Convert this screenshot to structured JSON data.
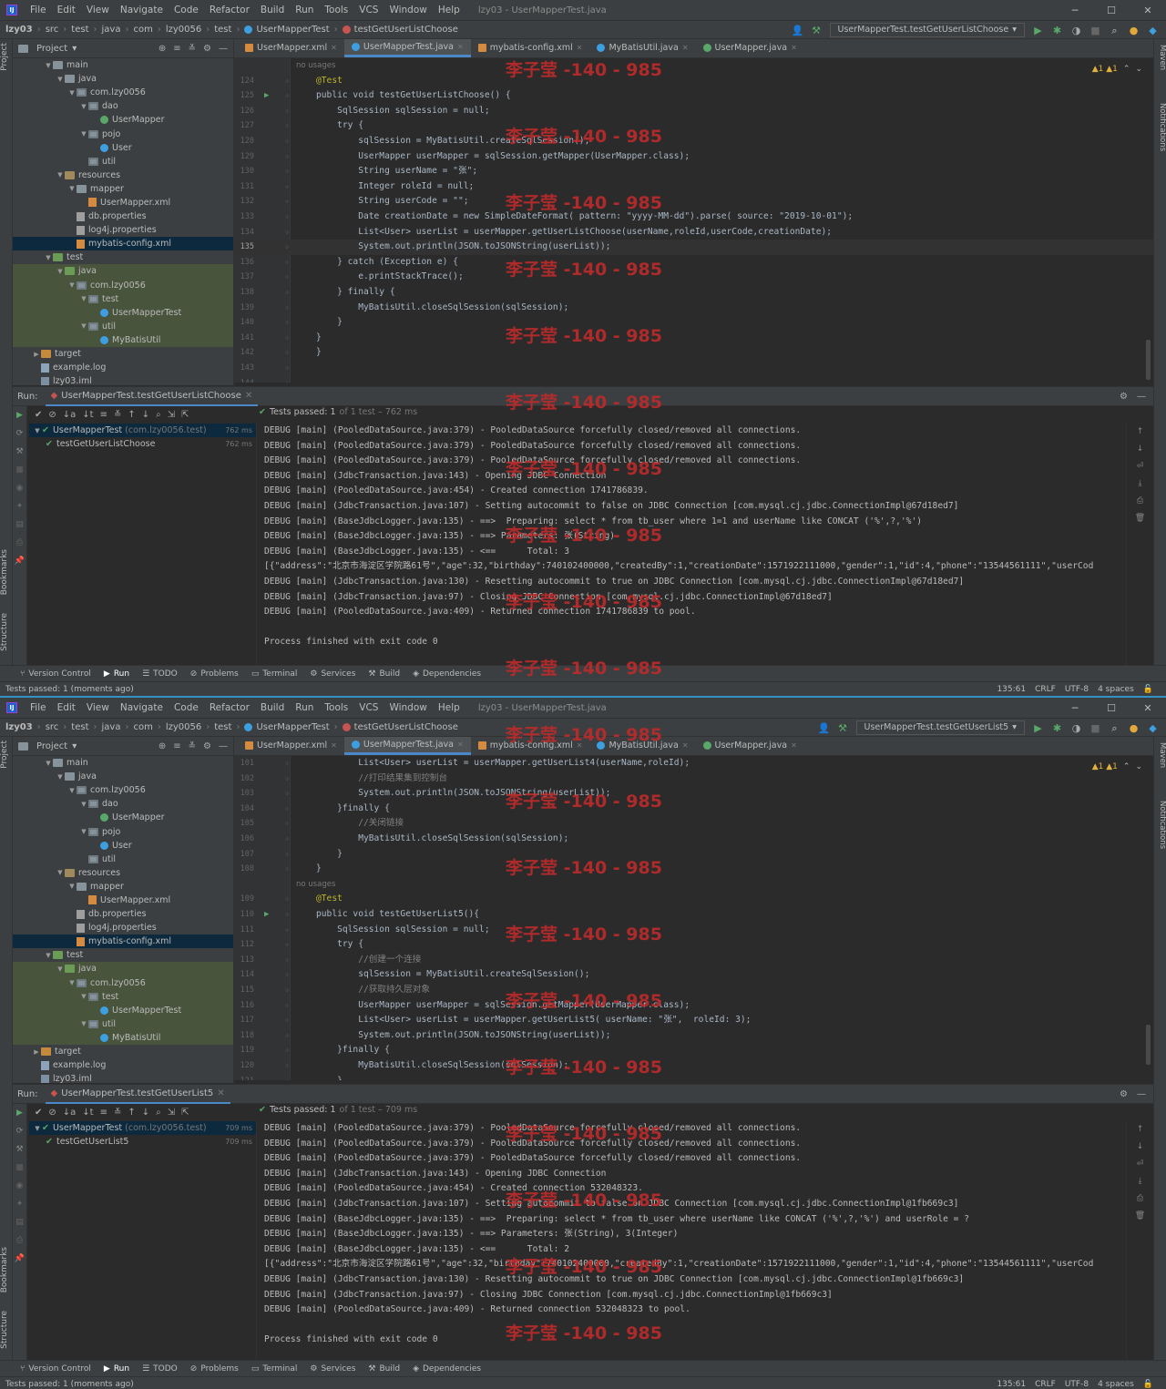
{
  "watermark_text": "李子莹 -140 - 985",
  "w1": {
    "menu": [
      "File",
      "Edit",
      "View",
      "Navigate",
      "Code",
      "Refactor",
      "Build",
      "Run",
      "Tools",
      "VCS",
      "Window",
      "Help"
    ],
    "window_title": "lzy03 - UserMapperTest.java",
    "breadcrumb": [
      "lzy03",
      "src",
      "test",
      "java",
      "com",
      "lzy0056",
      "test",
      "UserMapperTest",
      "testGetUserListChoose"
    ],
    "run_config": "UserMapperTest.testGetUserListChoose",
    "project_label": "Project",
    "tree": [
      {
        "label": "main",
        "indent": 2,
        "icon": "folder",
        "tw": "v"
      },
      {
        "label": "java",
        "indent": 3,
        "icon": "folder",
        "tw": "v"
      },
      {
        "label": "com.lzy0056",
        "indent": 4,
        "icon": "pkg",
        "tw": "v"
      },
      {
        "label": "dao",
        "indent": 5,
        "icon": "pkg",
        "tw": "v"
      },
      {
        "label": "UserMapper",
        "indent": 6,
        "icon": "ifc",
        "tw": ""
      },
      {
        "label": "pojo",
        "indent": 5,
        "icon": "pkg",
        "tw": "v"
      },
      {
        "label": "User",
        "indent": 6,
        "icon": "cls",
        "tw": ""
      },
      {
        "label": "util",
        "indent": 5,
        "icon": "pkg",
        "tw": ""
      },
      {
        "label": "resources",
        "indent": 3,
        "icon": "res",
        "tw": "v"
      },
      {
        "label": "mapper",
        "indent": 4,
        "icon": "folder",
        "tw": "v"
      },
      {
        "label": "UserMapper.xml",
        "indent": 5,
        "icon": "xml",
        "tw": ""
      },
      {
        "label": "db.properties",
        "indent": 4,
        "icon": "prop",
        "tw": ""
      },
      {
        "label": "log4j.properties",
        "indent": 4,
        "icon": "prop",
        "tw": ""
      },
      {
        "label": "mybatis-config.xml",
        "indent": 4,
        "icon": "xml",
        "tw": "",
        "sel": true
      },
      {
        "label": "test",
        "indent": 2,
        "icon": "tst",
        "tw": "v"
      },
      {
        "label": "java",
        "indent": 3,
        "icon": "tst",
        "tw": "v",
        "test": true
      },
      {
        "label": "com.lzy0056",
        "indent": 4,
        "icon": "pkg",
        "tw": "v",
        "test": true
      },
      {
        "label": "test",
        "indent": 5,
        "icon": "pkg",
        "tw": "v",
        "test": true
      },
      {
        "label": "UserMapperTest",
        "indent": 6,
        "icon": "cls",
        "tw": "",
        "test": true
      },
      {
        "label": "util",
        "indent": 5,
        "icon": "pkg",
        "tw": "v",
        "test": true
      },
      {
        "label": "MyBatisUtil",
        "indent": 6,
        "icon": "cls",
        "tw": "",
        "test": true
      },
      {
        "label": "target",
        "indent": 1,
        "icon": "out",
        "tw": ">"
      },
      {
        "label": "example.log",
        "indent": 1,
        "icon": "log",
        "tw": ""
      },
      {
        "label": "lzy03.iml",
        "indent": 1,
        "icon": "iml",
        "tw": ""
      }
    ],
    "tabs": [
      {
        "label": "UserMapper.xml",
        "icon": "xml"
      },
      {
        "label": "UserMapperTest.java",
        "icon": "cls",
        "active": true
      },
      {
        "label": "mybatis-config.xml",
        "icon": "xml"
      },
      {
        "label": "MyBatisUtil.java",
        "icon": "cls"
      },
      {
        "label": "UserMapper.java",
        "icon": "ifc"
      }
    ],
    "warnings": "▲1  ▲1",
    "code": [
      {
        "n": "",
        "t": "no usages",
        "k": "hint"
      },
      {
        "n": "124",
        "t": "@Test",
        "k": "ann"
      },
      {
        "n": "125",
        "t": "public void testGetUserListChoose() {",
        "run": true
      },
      {
        "n": "126",
        "t": "    SqlSession sqlSession = null;"
      },
      {
        "n": "127",
        "t": "    try {"
      },
      {
        "n": "128",
        "t": "        sqlSession = MyBatisUtil.createSqlSession();"
      },
      {
        "n": "129",
        "t": "        UserMapper userMapper = sqlSession.getMapper(UserMapper.class);"
      },
      {
        "n": "130",
        "t": "        String userName = \"张\";"
      },
      {
        "n": "131",
        "t": "        Integer roleId = null;"
      },
      {
        "n": "132",
        "t": "        String userCode = \"\";"
      },
      {
        "n": "133",
        "t": "        Date creationDate = new SimpleDateFormat( pattern: \"yyyy-MM-dd\").parse( source: \"2019-10-01\");"
      },
      {
        "n": "134",
        "t": "        List<User> userList = userMapper.getUserListChoose(userName,roleId,userCode,creationDate);"
      },
      {
        "n": "135",
        "t": "        System.out.println(JSON.toJSONString(userList));",
        "cur": true
      },
      {
        "n": "136",
        "t": "    } catch (Exception e) {"
      },
      {
        "n": "137",
        "t": "        e.printStackTrace();"
      },
      {
        "n": "138",
        "t": "    } finally {"
      },
      {
        "n": "139",
        "t": "        MyBatisUtil.closeSqlSession(sqlSession);"
      },
      {
        "n": "140",
        "t": "    }"
      },
      {
        "n": "141",
        "t": "}"
      },
      {
        "n": "142",
        "t": "}"
      },
      {
        "n": "143",
        "t": ""
      },
      {
        "n": "144",
        "t": ""
      }
    ],
    "run_label": "Run:",
    "run_tab": "UserMapperTest.testGetUserListChoose",
    "tests_passed": "Tests passed: 1",
    "tests_detail": "of 1 test – 762 ms",
    "test_tree": [
      {
        "label": "UserMapperTest",
        "pkg": "(com.lzy0056.test)",
        "time": "762 ms",
        "sel": true,
        "indent": 0
      },
      {
        "label": "testGetUserListChoose",
        "pkg": "",
        "time": "762 ms",
        "indent": 1
      }
    ],
    "console": [
      "DEBUG [main] (PooledDataSource.java:379) - PooledDataSource forcefully closed/removed all connections.",
      "DEBUG [main] (PooledDataSource.java:379) - PooledDataSource forcefully closed/removed all connections.",
      "DEBUG [main] (PooledDataSource.java:379) - PooledDataSource forcefully closed/removed all connections.",
      "DEBUG [main] (JdbcTransaction.java:143) - Opening JDBC Connection",
      "DEBUG [main] (PooledDataSource.java:454) - Created connection 1741786839.",
      "DEBUG [main] (JdbcTransaction.java:107) - Setting autocommit to false on JDBC Connection [com.mysql.cj.jdbc.ConnectionImpl@67d18ed7]",
      "DEBUG [main] (BaseJdbcLogger.java:135) - ==>  Preparing: select * from tb_user where 1=1 and userName like CONCAT ('%',?,'%')",
      "DEBUG [main] (BaseJdbcLogger.java:135) - ==> Parameters: 张(String)",
      "DEBUG [main] (BaseJdbcLogger.java:135) - <==      Total: 3",
      "[{\"address\":\"北京市海淀区学院路61号\",\"age\":32,\"birthday\":740102400000,\"createdBy\":1,\"creationDate\":1571922111000,\"gender\":1,\"id\":4,\"phone\":\"13544561111\",\"userCod",
      "DEBUG [main] (JdbcTransaction.java:130) - Resetting autocommit to true on JDBC Connection [com.mysql.cj.jdbc.ConnectionImpl@67d18ed7]",
      "DEBUG [main] (JdbcTransaction.java:97) - Closing JDBC Connection [com.mysql.cj.jdbc.ConnectionImpl@67d18ed7]",
      "DEBUG [main] (PooledDataSource.java:409) - Returned connection 1741786839 to pool.",
      "",
      "Process finished with exit code 0"
    ],
    "bottom_tabs": [
      "Version Control",
      "Run",
      "TODO",
      "Problems",
      "Terminal",
      "Services",
      "Build",
      "Dependencies"
    ],
    "status_left": "Tests passed: 1 (moments ago)",
    "status_right": [
      "135:61",
      "CRLF",
      "UTF-8",
      "4 spaces"
    ]
  },
  "w2": {
    "menu": [
      "File",
      "Edit",
      "View",
      "Navigate",
      "Code",
      "Refactor",
      "Build",
      "Run",
      "Tools",
      "VCS",
      "Window",
      "Help"
    ],
    "window_title": "lzy03 - UserMapperTest.java",
    "breadcrumb": [
      "lzy03",
      "src",
      "test",
      "java",
      "com",
      "lzy0056",
      "test",
      "UserMapperTest",
      "testGetUserListChoose"
    ],
    "run_config": "UserMapperTest.testGetUserList5",
    "project_label": "Project",
    "tree": [
      {
        "label": "main",
        "indent": 2,
        "icon": "folder",
        "tw": "v"
      },
      {
        "label": "java",
        "indent": 3,
        "icon": "folder",
        "tw": "v"
      },
      {
        "label": "com.lzy0056",
        "indent": 4,
        "icon": "pkg",
        "tw": "v"
      },
      {
        "label": "dao",
        "indent": 5,
        "icon": "pkg",
        "tw": "v"
      },
      {
        "label": "UserMapper",
        "indent": 6,
        "icon": "ifc",
        "tw": ""
      },
      {
        "label": "pojo",
        "indent": 5,
        "icon": "pkg",
        "tw": "v"
      },
      {
        "label": "User",
        "indent": 6,
        "icon": "cls",
        "tw": ""
      },
      {
        "label": "util",
        "indent": 5,
        "icon": "pkg",
        "tw": ""
      },
      {
        "label": "resources",
        "indent": 3,
        "icon": "res",
        "tw": "v"
      },
      {
        "label": "mapper",
        "indent": 4,
        "icon": "folder",
        "tw": "v"
      },
      {
        "label": "UserMapper.xml",
        "indent": 5,
        "icon": "xml",
        "tw": ""
      },
      {
        "label": "db.properties",
        "indent": 4,
        "icon": "prop",
        "tw": ""
      },
      {
        "label": "log4j.properties",
        "indent": 4,
        "icon": "prop",
        "tw": ""
      },
      {
        "label": "mybatis-config.xml",
        "indent": 4,
        "icon": "xml",
        "tw": "",
        "sel": true
      },
      {
        "label": "test",
        "indent": 2,
        "icon": "tst",
        "tw": "v"
      },
      {
        "label": "java",
        "indent": 3,
        "icon": "tst",
        "tw": "v",
        "test": true
      },
      {
        "label": "com.lzy0056",
        "indent": 4,
        "icon": "pkg",
        "tw": "v",
        "test": true
      },
      {
        "label": "test",
        "indent": 5,
        "icon": "pkg",
        "tw": "v",
        "test": true
      },
      {
        "label": "UserMapperTest",
        "indent": 6,
        "icon": "cls",
        "tw": "",
        "test": true
      },
      {
        "label": "util",
        "indent": 5,
        "icon": "pkg",
        "tw": "v",
        "test": true
      },
      {
        "label": "MyBatisUtil",
        "indent": 6,
        "icon": "cls",
        "tw": "",
        "test": true
      },
      {
        "label": "target",
        "indent": 1,
        "icon": "out",
        "tw": ">"
      },
      {
        "label": "example.log",
        "indent": 1,
        "icon": "log",
        "tw": ""
      },
      {
        "label": "lzy03.iml",
        "indent": 1,
        "icon": "iml",
        "tw": ""
      }
    ],
    "tabs": [
      {
        "label": "UserMapper.xml",
        "icon": "xml"
      },
      {
        "label": "UserMapperTest.java",
        "icon": "cls",
        "active": true
      },
      {
        "label": "mybatis-config.xml",
        "icon": "xml"
      },
      {
        "label": "MyBatisUtil.java",
        "icon": "cls"
      },
      {
        "label": "UserMapper.java",
        "icon": "ifc"
      }
    ],
    "warnings": "▲1  ▲1",
    "code": [
      {
        "n": "101",
        "t": "        List<User> userList = userMapper.getUserList4(userName,roleId);"
      },
      {
        "n": "102",
        "t": "        //打印结果集到控制台",
        "k": "cmt"
      },
      {
        "n": "103",
        "t": "        System.out.println(JSON.toJSONString(userList));"
      },
      {
        "n": "104",
        "t": "    }finally {"
      },
      {
        "n": "105",
        "t": "        //关闭链接",
        "k": "cmt"
      },
      {
        "n": "106",
        "t": "        MyBatisUtil.closeSqlSession(sqlSession);"
      },
      {
        "n": "107",
        "t": "    }"
      },
      {
        "n": "108",
        "t": "}"
      },
      {
        "n": "",
        "t": "no usages",
        "k": "hint"
      },
      {
        "n": "109",
        "t": "@Test",
        "k": "ann"
      },
      {
        "n": "110",
        "t": "public void testGetUserList5(){",
        "run": true
      },
      {
        "n": "111",
        "t": "    SqlSession sqlSession = null;"
      },
      {
        "n": "112",
        "t": "    try {"
      },
      {
        "n": "113",
        "t": "        //创建一个连接",
        "k": "cmt"
      },
      {
        "n": "114",
        "t": "        sqlSession = MyBatisUtil.createSqlSession();"
      },
      {
        "n": "115",
        "t": "        //获取持久层对象",
        "k": "cmt"
      },
      {
        "n": "116",
        "t": "        UserMapper userMapper = sqlSession.getMapper(UserMapper.class);"
      },
      {
        "n": "117",
        "t": "        List<User> userList = userMapper.getUserList5( userName: \"张\",  roleId: 3);"
      },
      {
        "n": "118",
        "t": "        System.out.println(JSON.toJSONString(userList));"
      },
      {
        "n": "119",
        "t": "    }finally {"
      },
      {
        "n": "120",
        "t": "        MyBatisUtil.closeSqlSession(sqlSession);"
      },
      {
        "n": "121",
        "t": "    }"
      }
    ],
    "run_label": "Run:",
    "run_tab": "UserMapperTest.testGetUserList5",
    "tests_passed": "Tests passed: 1",
    "tests_detail": "of 1 test – 709 ms",
    "test_tree": [
      {
        "label": "UserMapperTest",
        "pkg": "(com.lzy0056.test)",
        "time": "709 ms",
        "sel": true,
        "indent": 0
      },
      {
        "label": "testGetUserList5",
        "pkg": "",
        "time": "709 ms",
        "indent": 1
      }
    ],
    "console": [
      "DEBUG [main] (PooledDataSource.java:379) - PooledDataSource forcefully closed/removed all connections.",
      "DEBUG [main] (PooledDataSource.java:379) - PooledDataSource forcefully closed/removed all connections.",
      "DEBUG [main] (PooledDataSource.java:379) - PooledDataSource forcefully closed/removed all connections.",
      "DEBUG [main] (JdbcTransaction.java:143) - Opening JDBC Connection",
      "DEBUG [main] (PooledDataSource.java:454) - Created connection 532048323.",
      "DEBUG [main] (JdbcTransaction.java:107) - Setting autocommit to false on JDBC Connection [com.mysql.cj.jdbc.ConnectionImpl@1fb669c3]",
      "DEBUG [main] (BaseJdbcLogger.java:135) - ==>  Preparing: select * from tb_user where userName like CONCAT ('%',?,'%') and userRole = ?",
      "DEBUG [main] (BaseJdbcLogger.java:135) - ==> Parameters: 张(String), 3(Integer)",
      "DEBUG [main] (BaseJdbcLogger.java:135) - <==      Total: 2",
      "[{\"address\":\"北京市海淀区学院路61号\",\"age\":32,\"birthday\":740102400000,\"createdBy\":1,\"creationDate\":1571922111000,\"gender\":1,\"id\":4,\"phone\":\"13544561111\",\"userCod",
      "DEBUG [main] (JdbcTransaction.java:130) - Resetting autocommit to true on JDBC Connection [com.mysql.cj.jdbc.ConnectionImpl@1fb669c3]",
      "DEBUG [main] (JdbcTransaction.java:97) - Closing JDBC Connection [com.mysql.cj.jdbc.ConnectionImpl@1fb669c3]",
      "DEBUG [main] (PooledDataSource.java:409) - Returned connection 532048323 to pool.",
      "",
      "Process finished with exit code 0"
    ],
    "bottom_tabs": [
      "Version Control",
      "Run",
      "TODO",
      "Problems",
      "Terminal",
      "Services",
      "Build",
      "Dependencies"
    ],
    "status_left": "Tests passed: 1 (moments ago)",
    "status_right": [
      "135:61",
      "CRLF",
      "UTF-8",
      "4 spaces"
    ]
  }
}
